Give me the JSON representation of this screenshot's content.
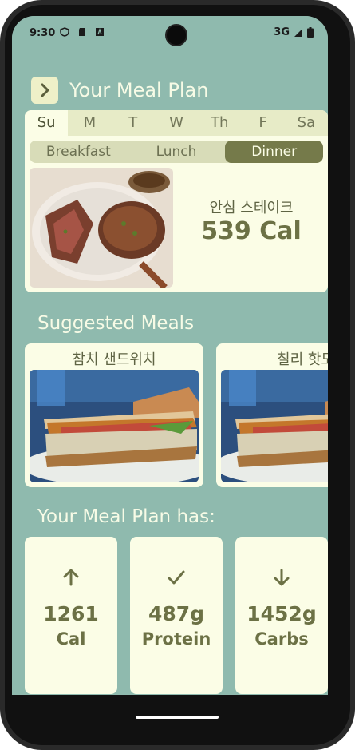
{
  "status": {
    "time": "9:30",
    "network": "3G"
  },
  "header": {
    "title": "Your Meal Plan"
  },
  "days": [
    "Su",
    "M",
    "T",
    "W",
    "Th",
    "F",
    "Sa"
  ],
  "meals": [
    "Breakfast",
    "Lunch",
    "Dinner"
  ],
  "plan": {
    "dish": "안심 스테이크",
    "calories": "539 Cal",
    "image": "steak-photo"
  },
  "suggested": {
    "title": "Suggested Meals",
    "items": [
      {
        "name": "참치 샌드위치",
        "image": "sandwich-photo"
      },
      {
        "name": "칠리 핫도",
        "image": "sandwich-photo"
      }
    ]
  },
  "summary": {
    "title": "Your Meal Plan has:",
    "stats": [
      {
        "value": "1261",
        "label": "Cal",
        "icon": "arrow-up-icon"
      },
      {
        "value": "487g",
        "label": "Protein",
        "icon": "check-icon"
      },
      {
        "value": "1452g",
        "label": "Carbs",
        "icon": "arrow-down-icon"
      }
    ]
  },
  "colors": {
    "background": "#8fbaae",
    "card": "#fbfde6",
    "accent": "#757a4a",
    "text": "#6c7145"
  }
}
